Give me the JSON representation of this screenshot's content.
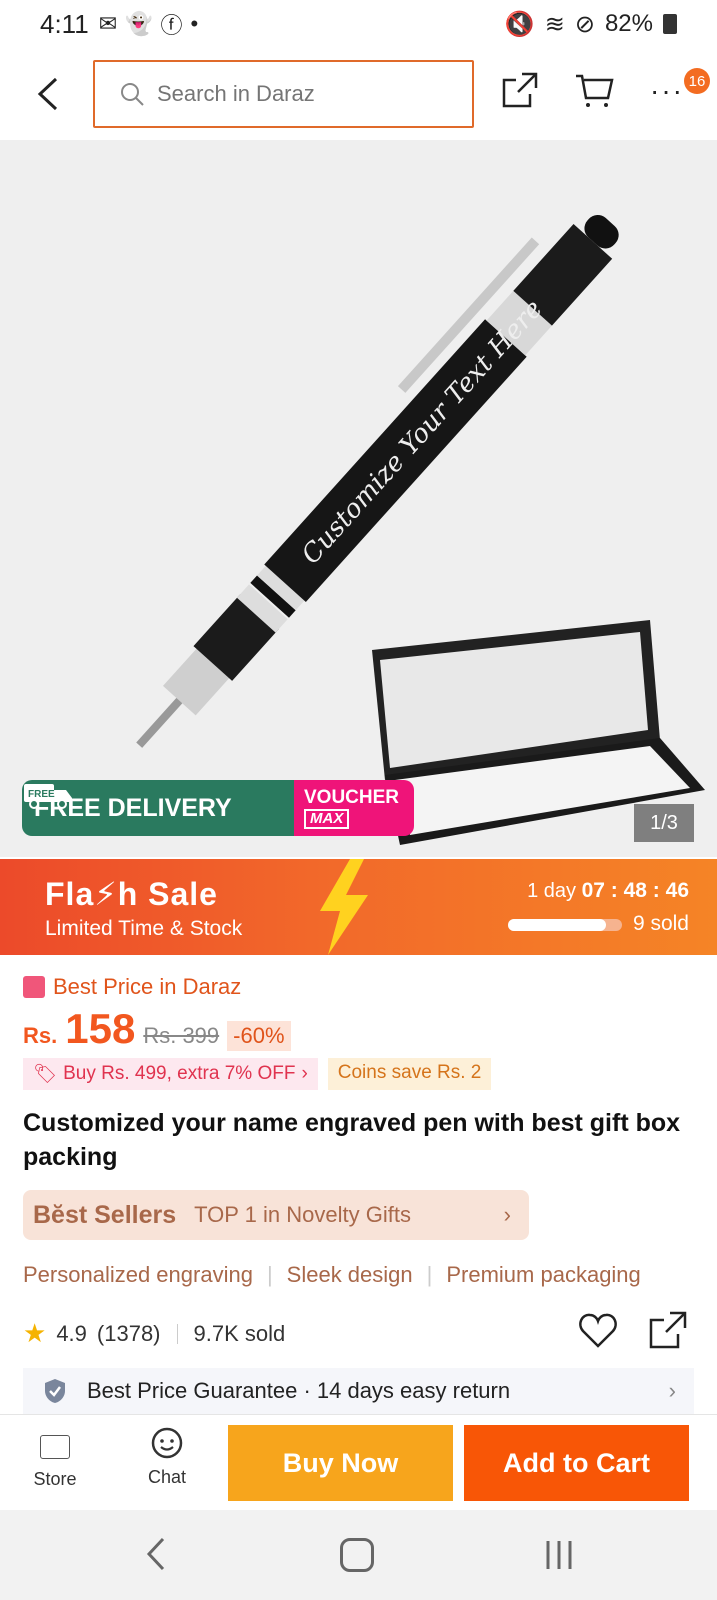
{
  "status_bar": {
    "time": "4:11",
    "battery": "82%",
    "notification_dot": "•"
  },
  "search": {
    "placeholder": "Search in Daraz",
    "cart_count": "16",
    "more_label": "···"
  },
  "hero": {
    "engraving_text": "Customize Your Text Here",
    "free_delivery": "FREE DELIVERY",
    "free_tag": "FREE",
    "voucher": "VOUCHER",
    "voucher_max": "MAX",
    "image_counter": "1/3"
  },
  "flash_sale": {
    "title": "Fla⚡h Sale",
    "subtitle": "Limited Time & Stock",
    "countdown_days": "1 day",
    "countdown_time": "07 : 48 : 46",
    "sold": "9 sold",
    "progress": 0.86
  },
  "pricing": {
    "best_price": "Best Price in Daraz",
    "currency": "Rs.",
    "price": "158",
    "old_price": "Rs. 399",
    "discount": "-60%",
    "promo": "Buy Rs. 499, extra 7% OFF",
    "promo_chevron": "›",
    "coins": "Coins save Rs. 2"
  },
  "product": {
    "title": "Customized your name engraved pen with best gift box packing",
    "bestseller_label": "Bĕst Sellers",
    "bestseller_text": "TOP 1 in Novelty Gifts",
    "bestseller_chevron": "›",
    "features": [
      "Personalized engraving",
      "Sleek design",
      "Premium packaging"
    ],
    "rating": "4.9",
    "rating_count": "(1378)",
    "sold": "9.7K sold",
    "guarantee": "Best Price Guarantee · 14 days easy return",
    "guarantee_chevron": "›"
  },
  "actions": {
    "store": "Store",
    "chat": "Chat",
    "buy_now": "Buy Now",
    "add_to_cart": "Add to Cart"
  },
  "colors": {
    "brand_orange": "#f85606",
    "buy_yellow": "#f7a51c",
    "delivery_green": "#2a7a5f",
    "voucher_pink": "#ef1479"
  }
}
